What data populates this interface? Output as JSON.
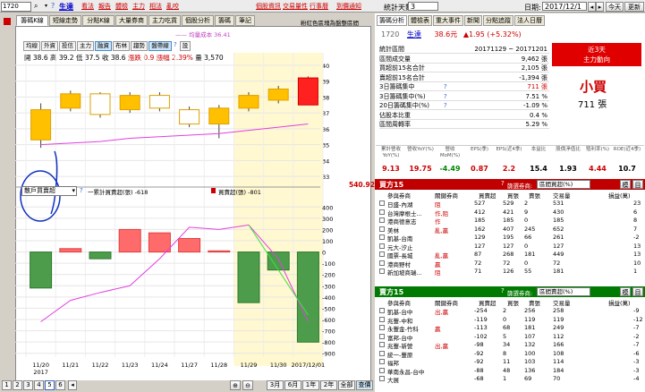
{
  "topbar": {
    "symbol": "1720",
    "stock_name": "生達",
    "links": [
      "看法",
      "報告",
      "體檢",
      "主力",
      "相法",
      "亂咬"
    ],
    "right_links": [
      "個股資訊",
      "交易量性",
      "行事曆",
      "到價通知"
    ],
    "days_label": "統計天數:",
    "days_value": "3",
    "date_label": "日期:",
    "date_value": "2017/12/1",
    "today": "今天",
    "refresh": "更新"
  },
  "left_tabs": [
    "籌碼K線",
    "短線走勢",
    "分點K線",
    "大量券商",
    "主力吃貨",
    "個股分析",
    "籌碼",
    "筆記"
  ],
  "left_tab_active": 0,
  "chart_right_title": "粉紅色區塊為盤整區間",
  "indicator_btns": [
    "均線",
    "外資",
    "投信",
    "主力",
    "融資",
    "布林",
    "趨勢",
    "盤帶線"
  ],
  "indicator_legend": "均量成本 36.41",
  "ohlc": {
    "open_label": "開",
    "open": "38.6",
    "high_label": "高",
    "high": "39.2",
    "low_label": "低",
    "low": "37.5",
    "close_label": "收",
    "close": "38.6",
    "chg_label": "漲跌",
    "chg": "0.9",
    "pct_label": "漲幅",
    "pct": "2.39%",
    "vol_label": "量",
    "vol": "3,570"
  },
  "price_ticks": [
    "40",
    "39",
    "38",
    "37",
    "36",
    "35",
    "34",
    "33"
  ],
  "lower_select": "散戶買賣超",
  "lower_legend1": "一累計買賣超(張) -618",
  "lower_legend2": "買賣超(張) -801",
  "lower_value_box": "540.92",
  "lower_ticks": [
    "400",
    "300",
    "200",
    "100",
    "0",
    "-100",
    "-200",
    "-300",
    "-400",
    "-500",
    "-600",
    "-700",
    "-800",
    "-900"
  ],
  "x_labels": [
    "11/20\n2017",
    "11/21",
    "11/22",
    "11/23",
    "11/24",
    "11/27",
    "11/28",
    "11/29",
    "11/30",
    "2017/12/01"
  ],
  "pages": [
    "1",
    "2",
    "3",
    "4",
    "5",
    "6"
  ],
  "range_btns": [
    "3月",
    "6月",
    "1年",
    "2年",
    "全部",
    "查價"
  ],
  "right_tabs": [
    "籌碼分析",
    "體檢表",
    "重大事件",
    "新聞",
    "分點追蹤",
    "法人日曆"
  ],
  "stock_line": {
    "code": "1720",
    "name": "生達",
    "price": "38.6元",
    "change": "▲1.95 (+5.32%)"
  },
  "stats": [
    {
      "label": "統計區間",
      "value": "20171129 ~ 20171201"
    },
    {
      "label": "區間成交量",
      "value": "9,462 張"
    },
    {
      "label": "買超前15名合計",
      "value": "2,105 張"
    },
    {
      "label": "賣超前15名合計",
      "value": "-1,394 張"
    },
    {
      "label": "3日籌碼集中",
      "value": "711 張"
    },
    {
      "label": "3日籌碼集中(%)",
      "value": "7.51 %"
    },
    {
      "label": "20日籌碼集中(%)",
      "value": "-1.09 %"
    },
    {
      "label": "佔股本比重",
      "value": "0.4 %"
    },
    {
      "label": "區間周轉率",
      "value": "5.29 %"
    }
  ],
  "trend_box": {
    "line1": "近3天",
    "line2": "主力動向",
    "verdict": "小買",
    "amount": "711 張"
  },
  "metrics_headers": [
    "累計營收YoY(%)",
    "營收YoY(%)",
    "營收MoM(%)",
    "EPS(季)",
    "EPS(近4季)",
    "本益比",
    "股價淨值比",
    "殖利率(%)",
    "ROE(近4季)"
  ],
  "metrics_values": [
    "9.13",
    "19.75",
    "-4.49",
    "0.87",
    "2.2",
    "15.4",
    "1.93",
    "4.44",
    "10.7"
  ],
  "buy_panel": {
    "title": "買方15",
    "filter_label": "篩選券商:",
    "filter_value": "區間買超(%)",
    "btn1": "模",
    "btn2": "目"
  },
  "table_headers": [
    "參與券商",
    "關鍵券商",
    "買賣超",
    "買張",
    "賣張",
    "交易量",
    "損益(萬)"
  ],
  "buy_rows": [
    [
      "日盛-內湖",
      "阻",
      "527",
      "529",
      "2",
      "531",
      "23"
    ],
    [
      "台灣摩根士...",
      "作,阻",
      "412",
      "421",
      "9",
      "430",
      "6"
    ],
    [
      "港商德意志",
      "作",
      "185",
      "185",
      "0",
      "185",
      "8"
    ],
    [
      "美林",
      "亂,贏",
      "162",
      "407",
      "245",
      "652",
      "7"
    ],
    [
      "凱基-台南",
      "",
      "129",
      "195",
      "66",
      "261",
      "-2"
    ],
    [
      "元大-汐止",
      "",
      "127",
      "127",
      "0",
      "127",
      "13"
    ],
    [
      "國票-長城",
      "亂,贏",
      "87",
      "268",
      "181",
      "449",
      "13"
    ],
    [
      "港商野村",
      "贏",
      "72",
      "72",
      "0",
      "72",
      "10"
    ],
    [
      "新加坡商瑞...",
      "阻",
      "71",
      "126",
      "55",
      "181",
      "1"
    ]
  ],
  "sell_panel": {
    "title": "賣方15",
    "filter_label": "篩選券商:",
    "filter_value": "區間賣超(%)",
    "btn1": "模",
    "btn2": "目"
  },
  "sell_rows": [
    [
      "凱基-台中",
      "出,贏",
      "-254",
      "2",
      "256",
      "258",
      "-9"
    ],
    [
      "兆豐-中和",
      "",
      "-119",
      "0",
      "119",
      "119",
      "-12"
    ],
    [
      "永豐金-竹科",
      "贏",
      "-113",
      "68",
      "181",
      "249",
      "-7"
    ],
    [
      "富邦-台中",
      "",
      "-102",
      "5",
      "107",
      "112",
      "-2"
    ],
    [
      "兆豐-新營",
      "出,贏",
      "-98",
      "34",
      "132",
      "166",
      "-7"
    ],
    [
      "統一-豐原",
      "",
      "-92",
      "8",
      "100",
      "108",
      "-6"
    ],
    [
      "福邦",
      "",
      "-92",
      "11",
      "103",
      "114",
      "-3"
    ],
    [
      "華南永昌-台中",
      "",
      "-88",
      "48",
      "136",
      "184",
      "-3"
    ],
    [
      "大展",
      "",
      "-68",
      "1",
      "69",
      "70",
      "-4"
    ]
  ],
  "chart_data": {
    "type": "bar",
    "categories": [
      "11/20",
      "11/21",
      "11/22",
      "11/23",
      "11/24",
      "11/27",
      "11/28",
      "11/29",
      "11/30",
      "12/01"
    ],
    "price_candles": [
      {
        "open": 35.3,
        "close": 37.2,
        "high": 37.6,
        "low": 34.8,
        "up": true
      },
      {
        "open": 37.3,
        "close": 38.2,
        "high": 38.4,
        "low": 37.1,
        "up": true
      },
      {
        "open": 38.2,
        "close": 36.9,
        "high": 38.3,
        "low": 36.7,
        "up": false
      },
      {
        "open": 37.2,
        "close": 38.1,
        "high": 38.3,
        "low": 37.0,
        "up": true
      },
      {
        "open": 38.1,
        "close": 37.3,
        "high": 38.3,
        "low": 37.1,
        "up": false
      },
      {
        "open": 37.2,
        "close": 36.3,
        "high": 37.4,
        "low": 36.1,
        "up": false
      },
      {
        "open": 36.3,
        "close": 37.3,
        "high": 37.5,
        "low": 35.4,
        "up": true
      },
      {
        "open": 37.3,
        "close": 38.1,
        "high": 38.3,
        "low": 37.1,
        "up": true
      },
      {
        "open": 37.8,
        "close": 38.5,
        "high": 38.7,
        "low": 37.6,
        "up": true
      },
      {
        "open": 37.5,
        "close": 39.2,
        "high": 39.3,
        "low": 37.5,
        "up": true
      }
    ],
    "ma_line": [
      35.0,
      35.1,
      35.2,
      35.4,
      35.5,
      35.6,
      35.7,
      35.9,
      36.1,
      36.3
    ],
    "net_buysell": [
      -320,
      30,
      -60,
      200,
      170,
      120,
      10,
      -450,
      -160,
      -801
    ],
    "cumulative": [
      -620,
      -430,
      -360,
      -300,
      -60,
      220,
      200,
      240,
      -60,
      -618
    ],
    "price_ylim": [
      32.5,
      40.5
    ],
    "lower_ylim": [
      -950,
      450
    ]
  },
  "colors": {
    "up": "#ffc000",
    "down_k": "#ffffff",
    "red": "#ff0000",
    "green": "#2e8b2e",
    "pink": "#e040e0",
    "buyhdr": "#c00000",
    "sellhdr": "#008000"
  }
}
